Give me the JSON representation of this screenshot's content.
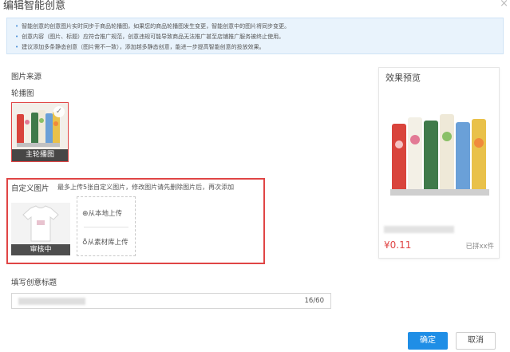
{
  "dialog": {
    "title": "编辑智能创意",
    "close_glyph": "×"
  },
  "notice": {
    "lines": [
      "智能创意的创意图片实时同步于商品轮播图，如果您的商品轮播图发生变更，智能创意中的图片将同步变更。",
      "创意内容（图片、标题）应符合推广规范，创意违规可能导致商品无法推广甚至店铺推广服务被终止使用。",
      "建议添加多条静态创意（图片需不一致），添加越多静态创意，能进一步提高智能创意的投放效果。"
    ]
  },
  "image_source": {
    "section_label": "图片来源",
    "carousel_label": "轮播图",
    "main_image_caption": "主轮播图",
    "check_glyph": "✓"
  },
  "custom_images": {
    "label": "自定义图片",
    "hint": "最多上传5张自定义图片，修改图片请先删除图片后，再次添加",
    "item_status": "审核中",
    "upload_local": "从本地上传",
    "upload_library": "从素材库上传"
  },
  "creative_title": {
    "label": "填写创意标题",
    "counter": "16/60"
  },
  "preview": {
    "title": "效果预览",
    "price": "¥0.11",
    "sold": "已拼xx件"
  },
  "buttons": {
    "ok": "确定",
    "cancel": "取消"
  },
  "colors": {
    "primary": "#1f8ee6",
    "highlight_border": "#e04545",
    "price": "#e04545",
    "notice_bg": "#e9f3fc"
  }
}
